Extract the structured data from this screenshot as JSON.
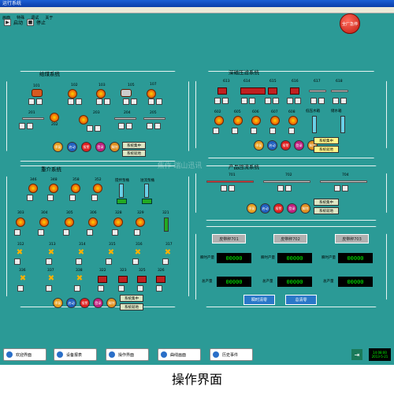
{
  "window": {
    "title": "运行系统"
  },
  "menu": [
    "画面",
    "特殊",
    "调试",
    "关于"
  ],
  "toolbar": {
    "start": "启动",
    "stop": "停止"
  },
  "estop": "全厂急停",
  "coal": {
    "title": "给煤系统",
    "tags1": [
      "101",
      "102",
      "103",
      "105",
      "107"
    ],
    "tags2": [
      "201",
      "202",
      "203",
      "204",
      "205"
    ],
    "buttons": [
      "系统集中",
      "系统就地"
    ]
  },
  "press": {
    "title": "深磁压滤系统",
    "tags1": [
      "613",
      "614",
      "615",
      "616",
      "617",
      "618"
    ],
    "tags2": [
      "602",
      "605",
      "606",
      "607",
      "608"
    ],
    "vlabels": [
      "低压水箱",
      "储水箱"
    ],
    "buttons": [
      "系统集中",
      "系统就地"
    ]
  },
  "heavy": {
    "title": "重介系统",
    "tags1": [
      "346",
      "348",
      "358",
      "352"
    ],
    "labels1": [
      "搅拌泵桶",
      "溢流泵桶"
    ],
    "tags2": [
      "303",
      "304",
      "305",
      "306",
      "328",
      "329",
      "321"
    ],
    "tags3": [
      "312",
      "313",
      "314",
      "315",
      "316",
      "317"
    ],
    "tags4": [
      "336",
      "337",
      "338",
      "322",
      "323",
      "325",
      "326"
    ],
    "buttons": [
      "系统集中",
      "系统就地"
    ]
  },
  "product": {
    "title": "产品回流系统",
    "tags": [
      "701",
      "702",
      "704"
    ],
    "buttons": [
      "系统集中",
      "系统就地"
    ]
  },
  "belt": {
    "scales": [
      "皮带秤701",
      "皮带秤702",
      "皮带秤703"
    ],
    "rows": [
      {
        "label": "瞬时产量",
        "values": [
          "00000",
          "00000",
          "00000"
        ]
      },
      {
        "label": "总产量",
        "values": [
          "00000",
          "00000",
          "00000"
        ]
      }
    ],
    "buttons": [
      "瞬时清零",
      "总清零"
    ]
  },
  "circles": [
    "停复",
    "启动",
    "报警",
    "登录",
    "解除"
  ],
  "nav": [
    "欢迎界面",
    "设备报表",
    "操作界面",
    "曲线画面",
    "历史事件"
  ],
  "clock": {
    "time": "14:08:00",
    "date": "2013-5-21"
  },
  "caption": "操作界面",
  "watermark": "焦作 瑞山迅讯"
}
